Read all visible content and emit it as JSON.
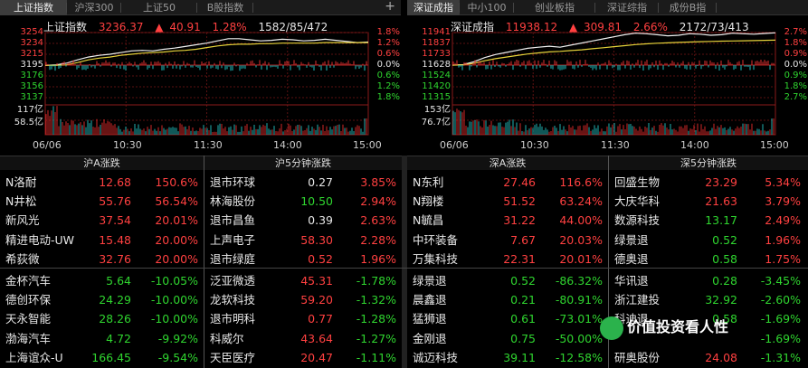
{
  "shanghai": {
    "tabs": [
      "上证指数",
      "沪深300",
      "上证50",
      "B股指数"
    ],
    "active_tab": 0,
    "name": "上证指数",
    "price": "3236.37",
    "change_arrow": "▲",
    "change": "40.91",
    "pct": "1.28%",
    "breadth": "1582/85/472",
    "left_axis": [
      "3254",
      "3234",
      "3215",
      "3195",
      "3176",
      "3156",
      "3137"
    ],
    "right_axis": [
      "1.8%",
      "1.2%",
      "0.6%",
      "0.0%",
      "0.6%",
      "1.2%",
      "1.8%"
    ],
    "vol_labels": [
      "117亿",
      "58.5亿"
    ],
    "x_labels": [
      "06/06",
      "10:30",
      "11:30",
      "14:00",
      "15:00"
    ],
    "chart_data": {
      "type": "line",
      "ylim": [
        3137,
        3254
      ],
      "base": 3195,
      "series": [
        {
          "values": [
            3195,
            3196,
            3199,
            3205,
            3210,
            3213,
            3215,
            3218,
            3221,
            3222,
            3221,
            3224,
            3226,
            3229,
            3232,
            3235,
            3239,
            3243,
            3243,
            3241,
            3239,
            3240,
            3242,
            3241,
            3239,
            3240,
            3242,
            3240,
            3238,
            3236,
            3237
          ]
        },
        {
          "values": [
            3195,
            3195,
            3196,
            3200,
            3205,
            3208,
            3210,
            3213,
            3215,
            3217,
            3218,
            3219,
            3221,
            3222,
            3224,
            3227,
            3230,
            3232,
            3233,
            3233,
            3234,
            3234,
            3235,
            3235,
            3235,
            3235,
            3236,
            3236,
            3236,
            3236,
            3236
          ]
        }
      ]
    }
  },
  "shenzhen": {
    "tabs": [
      "深证成指",
      "中小100",
      "创业板指",
      "深证综指",
      "成份B指"
    ],
    "active_tab": 0,
    "name": "深证成指",
    "price": "11938.12",
    "change_arrow": "▲",
    "change": "309.81",
    "pct": "2.66%",
    "breadth": "2172/73/413",
    "left_axis": [
      "11941",
      "11837",
      "11733",
      "11628",
      "11524",
      "11420",
      "11315"
    ],
    "right_axis": [
      "2.7%",
      "1.8%",
      "0.9%",
      "0.0%",
      "0.9%",
      "1.8%",
      "2.7%"
    ],
    "vol_labels": [
      "153亿",
      "76.7亿"
    ],
    "x_labels": [
      "06/06",
      "10:30",
      "11:30",
      "14:00",
      "15:00"
    ],
    "chart_data": {
      "type": "line",
      "ylim": [
        11315,
        11941
      ],
      "base": 11628,
      "series": [
        {
          "values": [
            11628,
            11632,
            11660,
            11700,
            11730,
            11750,
            11770,
            11790,
            11800,
            11810,
            11800,
            11820,
            11840,
            11860,
            11880,
            11900,
            11920,
            11935,
            11930,
            11920,
            11910,
            11915,
            11930,
            11925,
            11915,
            11920,
            11935,
            11930,
            11925,
            11932,
            11938
          ]
        },
        {
          "values": [
            11628,
            11630,
            11645,
            11670,
            11690,
            11705,
            11720,
            11735,
            11745,
            11755,
            11760,
            11768,
            11775,
            11785,
            11795,
            11805,
            11815,
            11825,
            11832,
            11838,
            11842,
            11846,
            11850,
            11853,
            11856,
            11858,
            11860,
            11862,
            11864,
            11866,
            11868
          ]
        }
      ]
    }
  },
  "sections": [
    "沪A涨跌",
    "沪5分钟涨跌",
    "深A涨跌",
    "深5分钟涨跌"
  ],
  "lists": {
    "sh_a": [
      {
        "name": "N洛耐",
        "price": "12.68",
        "pct": "150.6%",
        "dir": "up"
      },
      {
        "name": "N井松",
        "price": "55.76",
        "pct": "56.54%",
        "dir": "up"
      },
      {
        "name": "新风光",
        "price": "37.54",
        "pct": "20.01%",
        "dir": "up"
      },
      {
        "name": "精进电动-UW",
        "price": "15.48",
        "pct": "20.00%",
        "dir": "up"
      },
      {
        "name": "希荻微",
        "price": "32.76",
        "pct": "20.00%",
        "dir": "up"
      },
      {
        "name": "金杯汽车",
        "price": "5.64",
        "pct": "-10.05%",
        "dir": "down"
      },
      {
        "name": "德创环保",
        "price": "24.29",
        "pct": "-10.00%",
        "dir": "down"
      },
      {
        "name": "天永智能",
        "price": "28.26",
        "pct": "-10.00%",
        "dir": "down"
      },
      {
        "name": "渤海汽车",
        "price": "4.72",
        "pct": "-9.92%",
        "dir": "down"
      },
      {
        "name": "上海谊众-U",
        "price": "166.45",
        "pct": "-9.54%",
        "dir": "down"
      }
    ],
    "sh_5": [
      {
        "name": "退市环球",
        "price": "0.27",
        "pct": "3.85%",
        "dir": "up",
        "pc": "wht"
      },
      {
        "name": "林海股份",
        "price": "10.50",
        "pct": "2.94%",
        "dir": "up",
        "pc": "grn"
      },
      {
        "name": "退市昌鱼",
        "price": "0.39",
        "pct": "2.63%",
        "dir": "up",
        "pc": "wht"
      },
      {
        "name": "上声电子",
        "price": "58.30",
        "pct": "2.28%",
        "dir": "up",
        "pc": "red"
      },
      {
        "name": "退市绿庭",
        "price": "0.52",
        "pct": "1.96%",
        "dir": "up",
        "pc": "red"
      },
      {
        "name": "泛亚微透",
        "price": "45.31",
        "pct": "-1.78%",
        "dir": "down",
        "pc": "red"
      },
      {
        "name": "龙软科技",
        "price": "59.20",
        "pct": "-1.32%",
        "dir": "down",
        "pc": "red"
      },
      {
        "name": "退市明科",
        "price": "0.77",
        "pct": "-1.28%",
        "dir": "down",
        "pc": "red"
      },
      {
        "name": "科威尔",
        "price": "43.64",
        "pct": "-1.27%",
        "dir": "down",
        "pc": "red"
      },
      {
        "name": "天臣医疗",
        "price": "20.47",
        "pct": "-1.11%",
        "dir": "down",
        "pc": "red"
      }
    ],
    "sz_a": [
      {
        "name": "N东利",
        "price": "27.46",
        "pct": "116.6%",
        "dir": "up"
      },
      {
        "name": "N翔楼",
        "price": "51.52",
        "pct": "63.24%",
        "dir": "up"
      },
      {
        "name": "N毓昌",
        "price": "31.22",
        "pct": "44.00%",
        "dir": "up"
      },
      {
        "name": "中环装备",
        "price": "7.67",
        "pct": "20.03%",
        "dir": "up"
      },
      {
        "name": "万集科技",
        "price": "22.31",
        "pct": "20.01%",
        "dir": "up"
      },
      {
        "name": "绿景退",
        "price": "0.52",
        "pct": "-86.32%",
        "dir": "down"
      },
      {
        "name": "晨鑫退",
        "price": "0.21",
        "pct": "-80.91%",
        "dir": "down"
      },
      {
        "name": "猛狮退",
        "price": "0.61",
        "pct": "-73.01%",
        "dir": "down"
      },
      {
        "name": "金刚退",
        "price": "0.75",
        "pct": "-50.00%",
        "dir": "down"
      },
      {
        "name": "诚迈科技",
        "price": "39.11",
        "pct": "-12.58%",
        "dir": "down"
      }
    ],
    "sz_5": [
      {
        "name": "回盛生物",
        "price": "23.29",
        "pct": "5.34%",
        "dir": "up",
        "pc": "red"
      },
      {
        "name": "大庆华科",
        "price": "21.63",
        "pct": "3.79%",
        "dir": "up",
        "pc": "red"
      },
      {
        "name": "数源科技",
        "price": "13.17",
        "pct": "2.49%",
        "dir": "up",
        "pc": "grn"
      },
      {
        "name": "绿景退",
        "price": "0.52",
        "pct": "1.96%",
        "dir": "up",
        "pc": "grn"
      },
      {
        "name": "德奥退",
        "price": "0.58",
        "pct": "1.75%",
        "dir": "up",
        "pc": "grn"
      },
      {
        "name": "华讯退",
        "price": "0.28",
        "pct": "-3.45%",
        "dir": "down",
        "pc": "grn"
      },
      {
        "name": "浙江建投",
        "price": "32.92",
        "pct": "-2.60%",
        "dir": "down",
        "pc": "grn"
      },
      {
        "name": "科迪退",
        "price": "0.58",
        "pct": "-1.69%",
        "dir": "down",
        "pc": "grn"
      },
      {
        "name": "",
        "price": "",
        "pct": "-1.69%",
        "dir": "down",
        "pc": "grn"
      },
      {
        "name": "研奥股份",
        "price": "24.08",
        "pct": "-1.31%",
        "dir": "down",
        "pc": "red"
      }
    ]
  },
  "watermark": "价值投资看人性"
}
